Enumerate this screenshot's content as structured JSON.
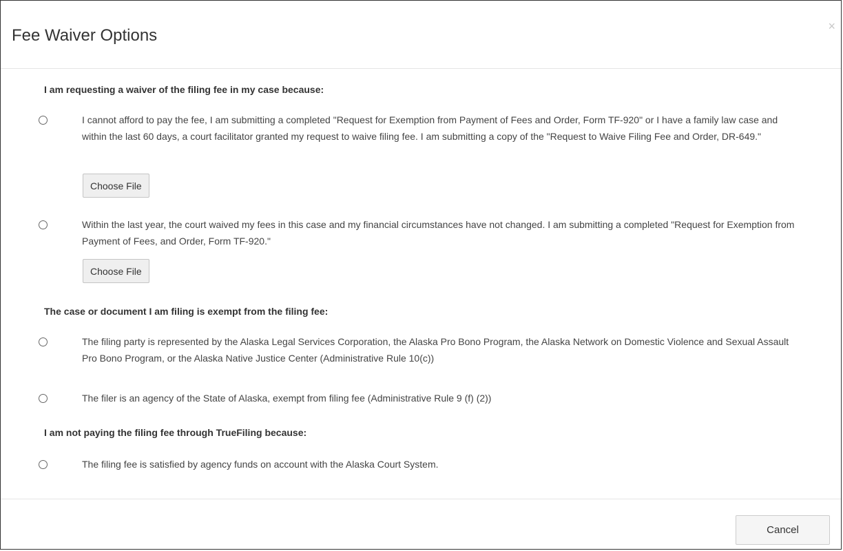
{
  "modal": {
    "title": "Fee Waiver Options",
    "close_glyph": "×"
  },
  "sections": {
    "waiver": {
      "heading": "I am requesting a waiver of the filing fee in my case because:",
      "options": [
        {
          "text": "I cannot afford to pay the fee, I am submitting a completed \"Request for Exemption from Payment of Fees and Order, Form TF-920\" or I have a family law case and within the last 60 days, a court facilitator granted my request to waive filing fee. I am submitting a copy of the \"Request to Waive Filing Fee and Order, DR-649.\"",
          "file_button": "Choose File"
        },
        {
          "text": "Within the last year, the court waived my fees in this case and my financial circumstances have not changed. I am submitting a completed \"Request for Exemption from Payment of Fees, and Order, Form TF-920.\"",
          "file_button": "Choose File"
        }
      ]
    },
    "exempt": {
      "heading": "The case or document I am filing is exempt from the filing fee:",
      "options": [
        {
          "text": "The filing party is represented by the Alaska Legal Services Corporation, the Alaska Pro Bono Program, the Alaska Network on Domestic Violence and Sexual Assault Pro Bono Program, or the Alaska Native Justice Center (Administrative Rule 10(c))"
        },
        {
          "text": "The filer is an agency of the State of Alaska, exempt from filing fee (Administrative Rule 9 (f) (2))"
        }
      ]
    },
    "not_paying": {
      "heading": "I am not paying the filing fee through TrueFiling because:",
      "options": [
        {
          "text": "The filing fee is satisfied by agency funds on account with the Alaska Court System."
        }
      ]
    }
  },
  "footer": {
    "cancel_label": "Cancel"
  }
}
